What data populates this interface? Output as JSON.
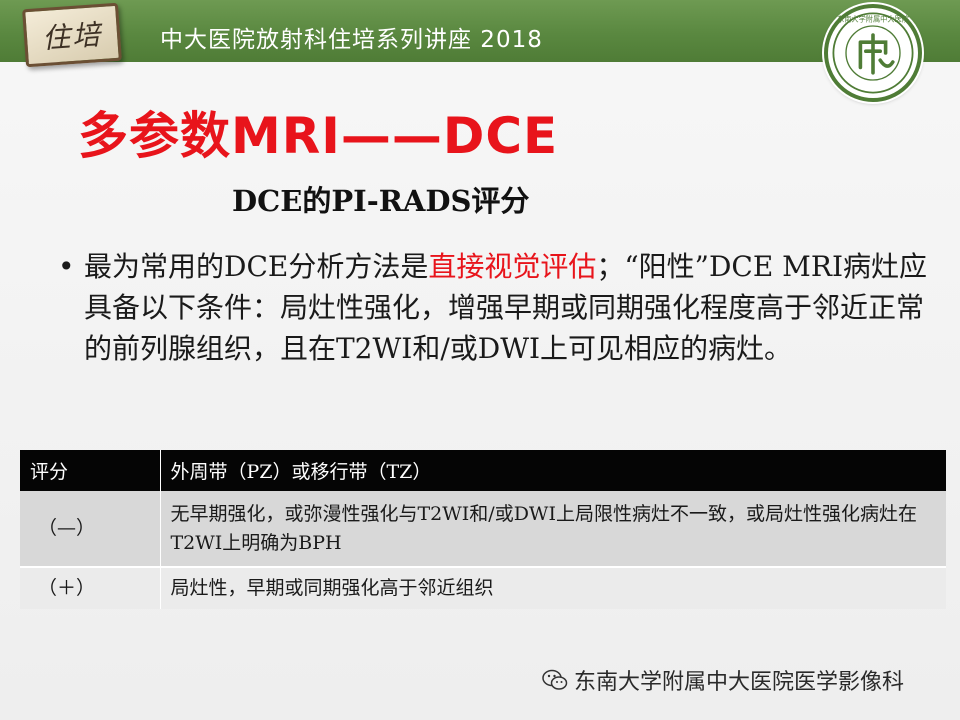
{
  "header": {
    "logo_text": "住培",
    "title": "中大医院放射科住培系列讲座 2018",
    "seal_label": "东南大学附属中大医院"
  },
  "slide": {
    "title": "多参数MRI——DCE",
    "subtitle": "DCE的PI-RADS评分",
    "bullet": {
      "part1": "最为常用的DCE分析方法是",
      "highlight": "直接视觉评估",
      "part2": "；“阳性”DCE MRI病灶应具备以下条件：局灶性强化，增强早期或同期强化程度高于邻近正常的前列腺组织，且在T2WI和/或DWI上可见相应的病灶。"
    }
  },
  "table": {
    "headers": [
      "评分",
      "外周带（PZ）或移行带（TZ）"
    ],
    "rows": [
      {
        "score": "（—）",
        "desc": "无早期强化，或弥漫性强化与T2WI和/或DWI上局限性病灶不一致，或局灶性强化病灶在T2WI上明确为BPH"
      },
      {
        "score": "（＋）",
        "desc": "局灶性，早期或同期强化高于邻近组织"
      }
    ]
  },
  "watermark": {
    "icon": "wechat-icon",
    "text": "东南大学附属中大医院医学影像科"
  },
  "colors": {
    "banner": "#5a8840",
    "title_red": "#e8141b",
    "table_header": "#050505"
  }
}
